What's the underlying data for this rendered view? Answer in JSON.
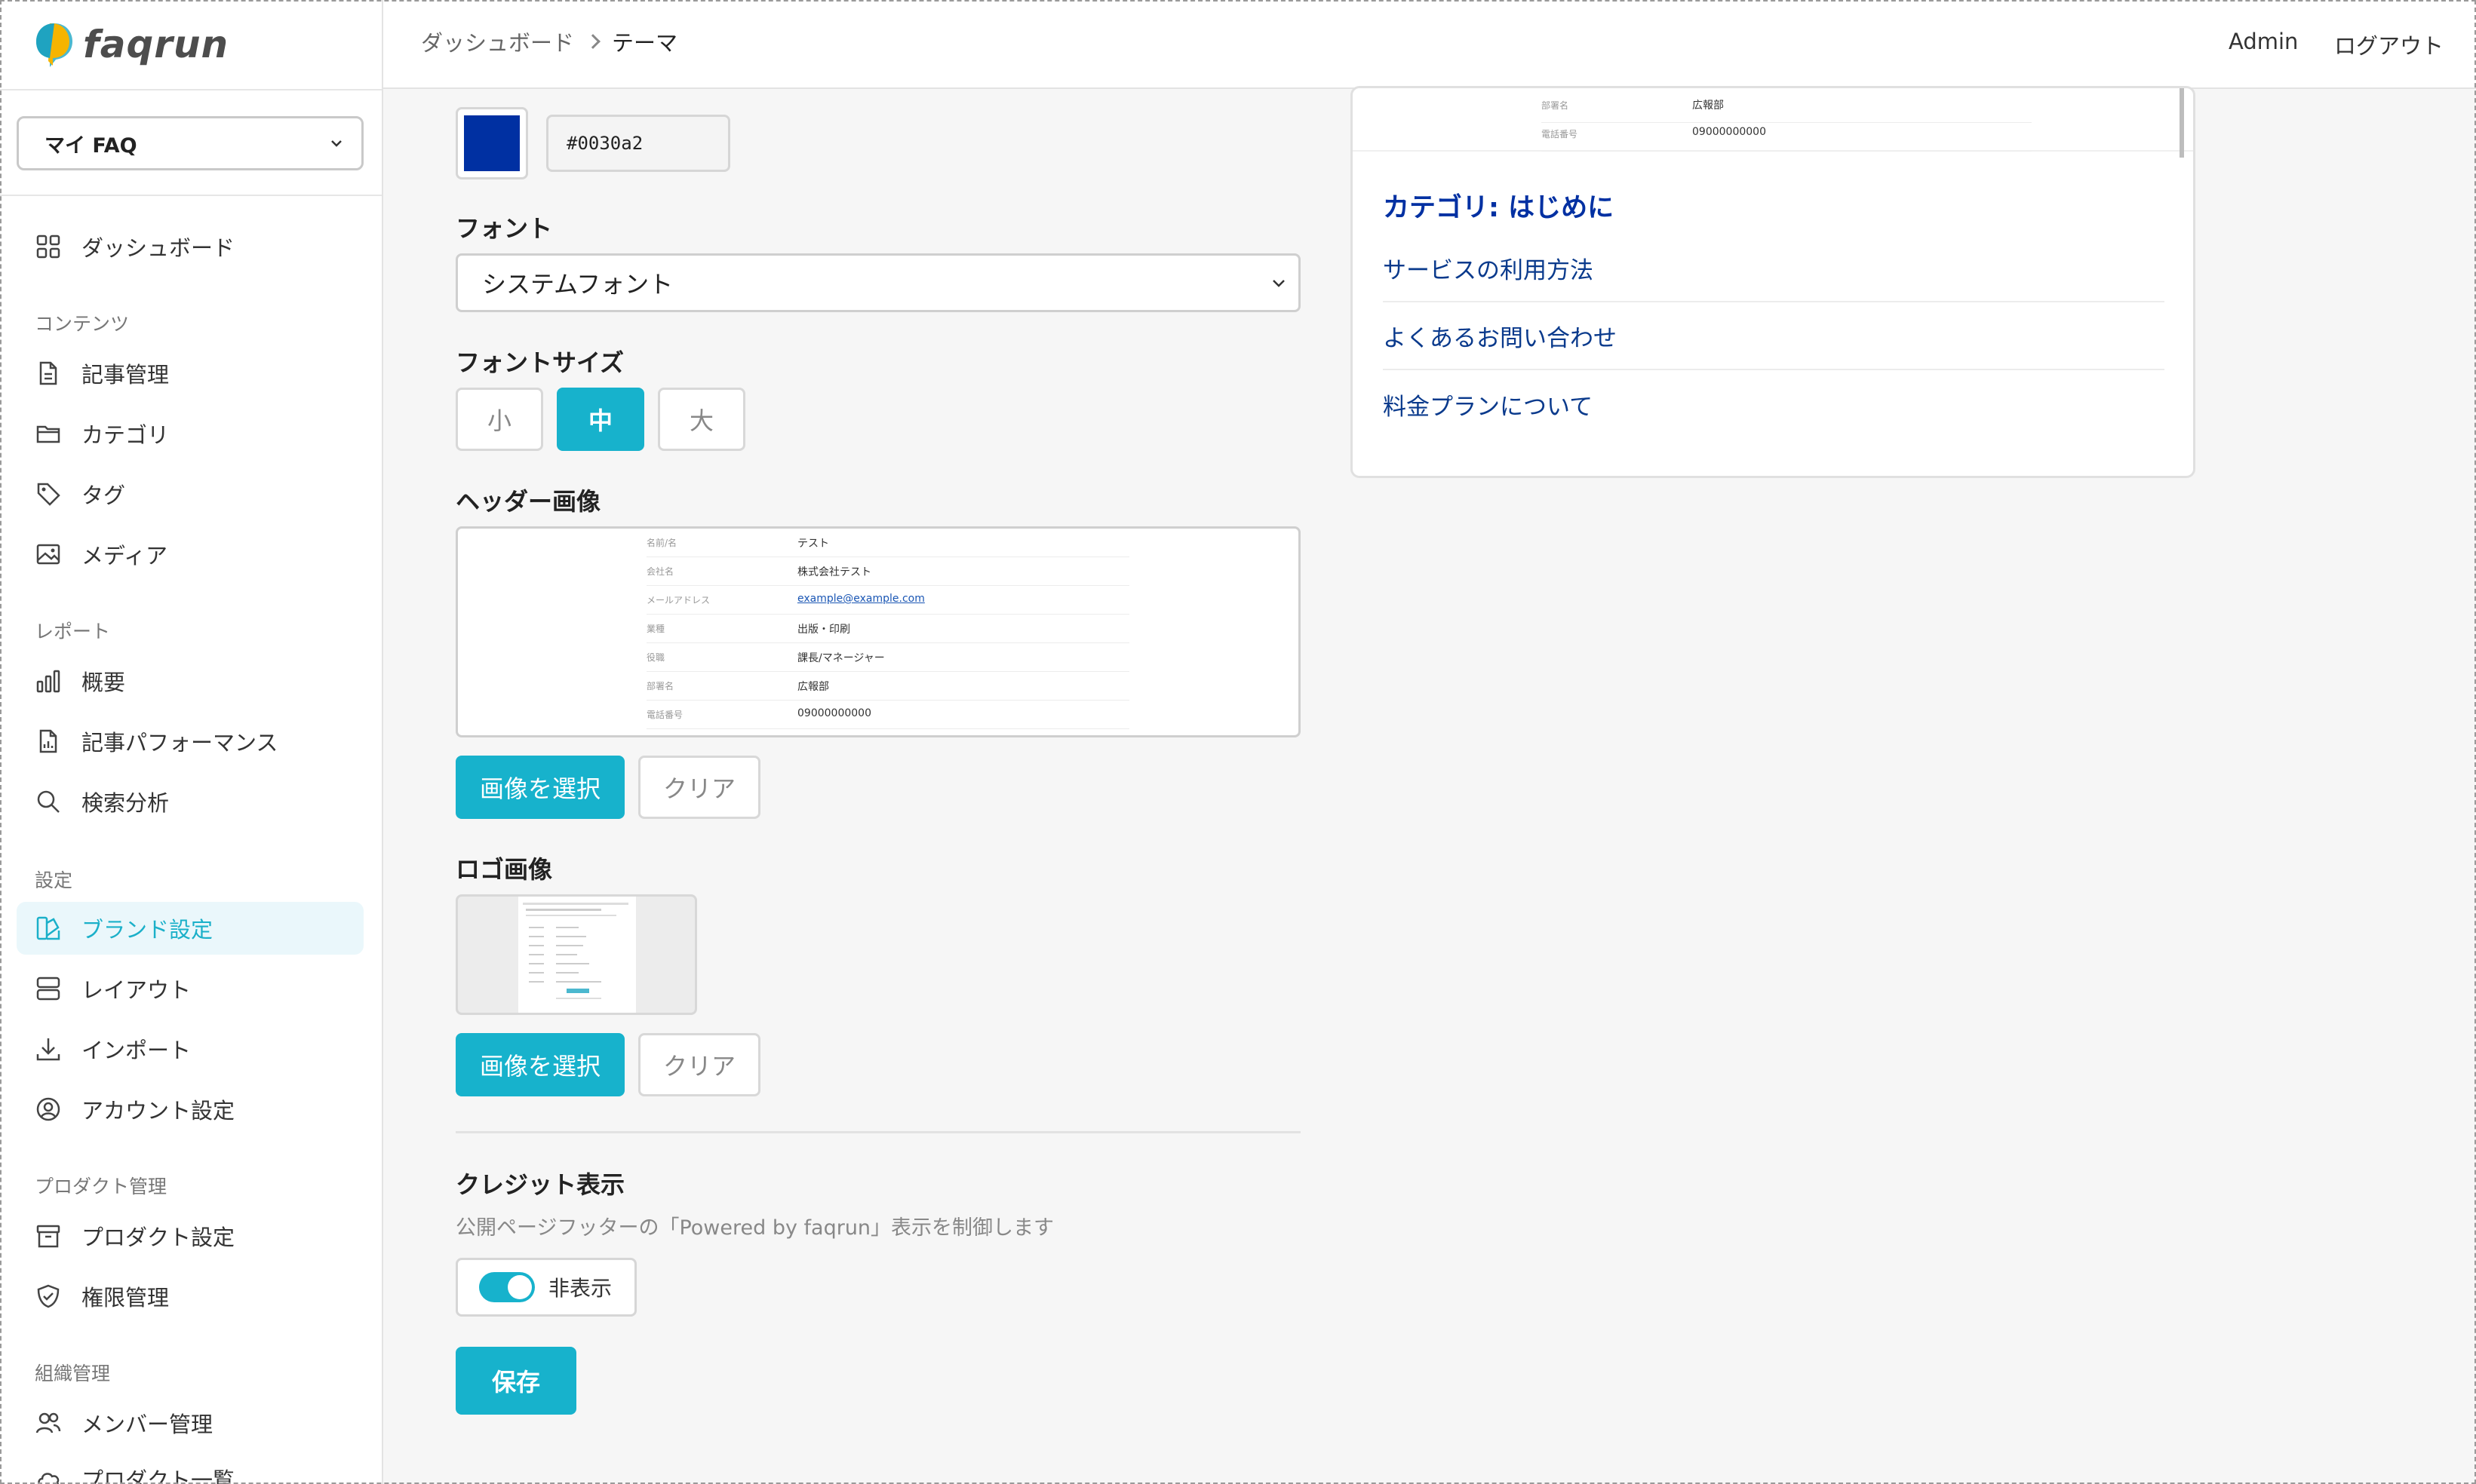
{
  "app": {
    "logo_text": "faqrun"
  },
  "sidebar": {
    "faq_select": "マイ FAQ",
    "dashboard": "ダッシュボード",
    "sections": {
      "content": "コンテンツ",
      "reports": "レポート",
      "settings": "設定",
      "product": "プロダクト管理",
      "org": "組織管理"
    },
    "items": {
      "articles": "記事管理",
      "categories": "カテゴリ",
      "tags": "タグ",
      "media": "メディア",
      "overview": "概要",
      "article_performance": "記事パフォーマンス",
      "search_analysis": "検索分析",
      "brand_settings": "ブランド設定",
      "layout": "レイアウト",
      "import": "インポート",
      "account_settings": "アカウント設定",
      "product_settings": "プロダクト設定",
      "permissions": "権限管理",
      "members": "メンバー管理",
      "product_list": "プロダクト一覧"
    }
  },
  "header": {
    "breadcrumb": [
      "ダッシュボード",
      "テーマ"
    ],
    "admin": "Admin",
    "logout": "ログアウト"
  },
  "theme": {
    "color_value": "#0030a2",
    "font_label": "フォント",
    "font_value": "システムフォント",
    "font_size_label": "フォントサイズ",
    "font_sizes": [
      "小",
      "中",
      "大"
    ],
    "font_size_selected": "中",
    "header_image_label": "ヘッダー画像",
    "logo_image_label": "ロゴ画像",
    "select_image": "画像を選択",
    "clear": "クリア",
    "credit_label": "クレジット表示",
    "credit_desc": "公開ページフッターの「Powered by faqrun」表示を制御します",
    "credit_toggle": "非表示",
    "save": "保存"
  },
  "header_image_rows": [
    {
      "k": "名前/名",
      "v": "テスト"
    },
    {
      "k": "会社名",
      "v": "株式会社テスト"
    },
    {
      "k": "メールアドレス",
      "v": "example@example.com"
    },
    {
      "k": "業種",
      "v": "出版・印刷"
    },
    {
      "k": "役職",
      "v": "課長/マネージャー"
    },
    {
      "k": "部署名",
      "v": "広報部"
    },
    {
      "k": "電話番号",
      "v": "09000000000"
    }
  ],
  "preview": {
    "top_rows": [
      {
        "k": "部署名",
        "v": "広報部"
      },
      {
        "k": "電話番号",
        "v": "09000000000"
      }
    ],
    "category_title": "カテゴリ: はじめに",
    "articles": [
      "サービスの利用方法",
      "よくあるお問い合わせ",
      "料金プランについて"
    ]
  },
  "colors": {
    "accent": "#17b2cc",
    "brand": "#0030a2"
  }
}
